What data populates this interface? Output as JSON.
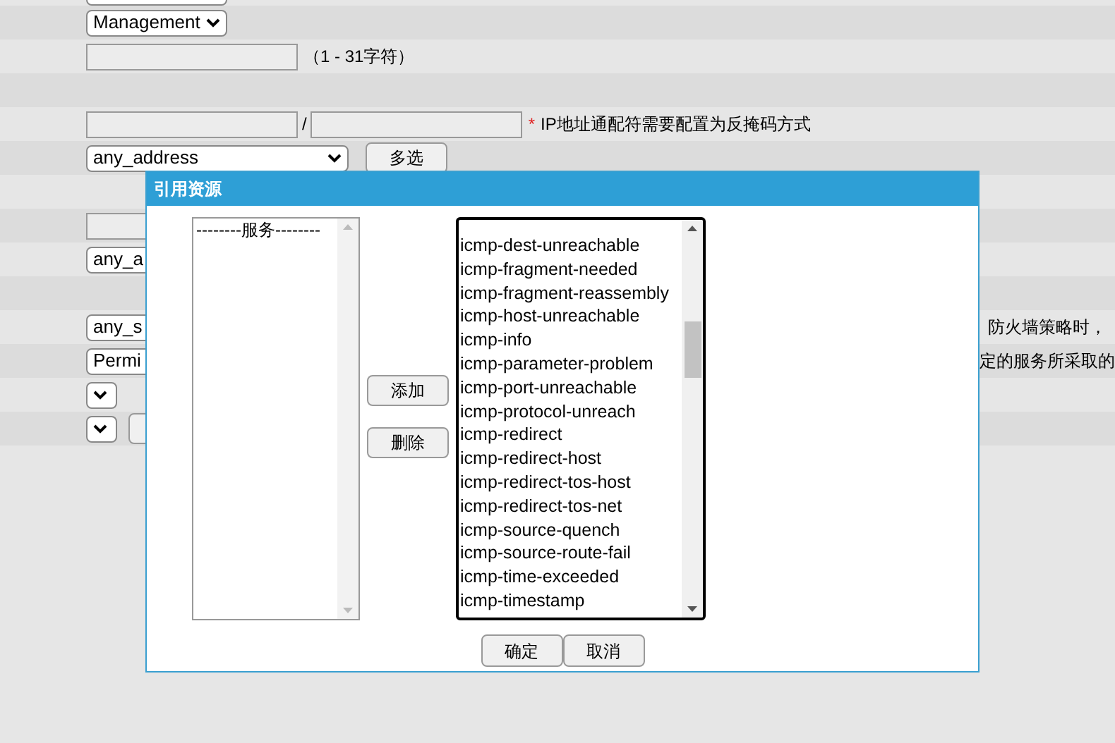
{
  "form_rows": [
    {
      "kind": "select_cut"
    },
    {
      "kind": "select",
      "value": "Management"
    },
    {
      "kind": "text",
      "hint": "（1 - 31字符）"
    },
    {
      "kind": "empty"
    },
    {
      "kind": "ip",
      "separator": "/",
      "required_mark": "*",
      "note": "IP地址通配符需要配置为反掩码方式"
    },
    {
      "kind": "select_button",
      "value": "any_address",
      "button": "多选"
    },
    {
      "kind": "empty"
    },
    {
      "kind": "input"
    },
    {
      "kind": "select",
      "value": "any_a"
    },
    {
      "kind": "empty"
    },
    {
      "kind": "select",
      "value": "any_s",
      "note": "防火墙策略时，"
    },
    {
      "kind": "select",
      "value": "Permi",
      "note": "定的服务所采取的"
    },
    {
      "kind": "small_select"
    },
    {
      "kind": "small_select_button"
    },
    {
      "kind": "empty"
    }
  ],
  "dialog": {
    "title": "引用资源",
    "left_list": [
      "--------服务--------"
    ],
    "add_button": "添加",
    "remove_button": "删除",
    "right_list": [
      "icmp-dest-unreachable",
      "icmp-fragment-needed",
      "icmp-fragment-reassembly",
      "icmp-host-unreachable",
      "icmp-info",
      "icmp-parameter-problem",
      "icmp-port-unreachable",
      "icmp-protocol-unreach",
      "icmp-redirect",
      "icmp-redirect-host",
      "icmp-redirect-tos-host",
      "icmp-redirect-tos-net",
      "icmp-source-quench",
      "icmp-source-route-fail",
      "icmp-time-exceeded",
      "icmp-timestamp"
    ],
    "buttons": [
      "确定",
      "取消"
    ]
  }
}
